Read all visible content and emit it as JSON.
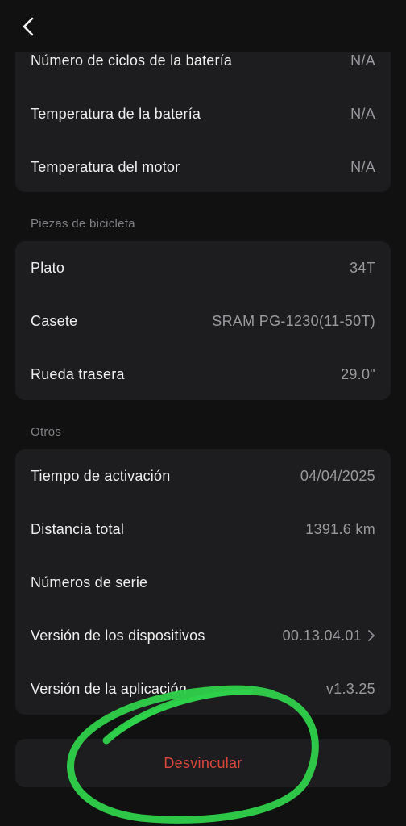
{
  "header": {
    "back_icon": "chevron-left-icon"
  },
  "battery_card": {
    "rows": [
      {
        "label": "Número de ciclos de la batería",
        "value": "N/A"
      },
      {
        "label": "Temperatura de la batería",
        "value": "N/A"
      },
      {
        "label": "Temperatura del motor",
        "value": "N/A"
      }
    ]
  },
  "parts_section": {
    "title": "Piezas de bicicleta",
    "rows": [
      {
        "label": "Plato",
        "value": "34T"
      },
      {
        "label": "Casete",
        "value": "SRAM PG-1230(11-50T)"
      },
      {
        "label": "Rueda trasera",
        "value": "29.0\""
      }
    ]
  },
  "others_section": {
    "title": "Otros",
    "rows": [
      {
        "label": "Tiempo de activación",
        "value": "04/04/2025"
      },
      {
        "label": "Distancia total",
        "value": "1391.6 km"
      },
      {
        "label": "Números de serie",
        "value": ""
      },
      {
        "label": "Versión de los dispositivos",
        "value": "00.13.04.01"
      },
      {
        "label": "Versión de la aplicación",
        "value": "v1.3.25"
      }
    ]
  },
  "unlink_button": {
    "label": "Desvincular"
  },
  "colors": {
    "background": "#111112",
    "card": "#1d1d1f",
    "danger": "#d9473c",
    "annotation": "#2fd14a"
  }
}
